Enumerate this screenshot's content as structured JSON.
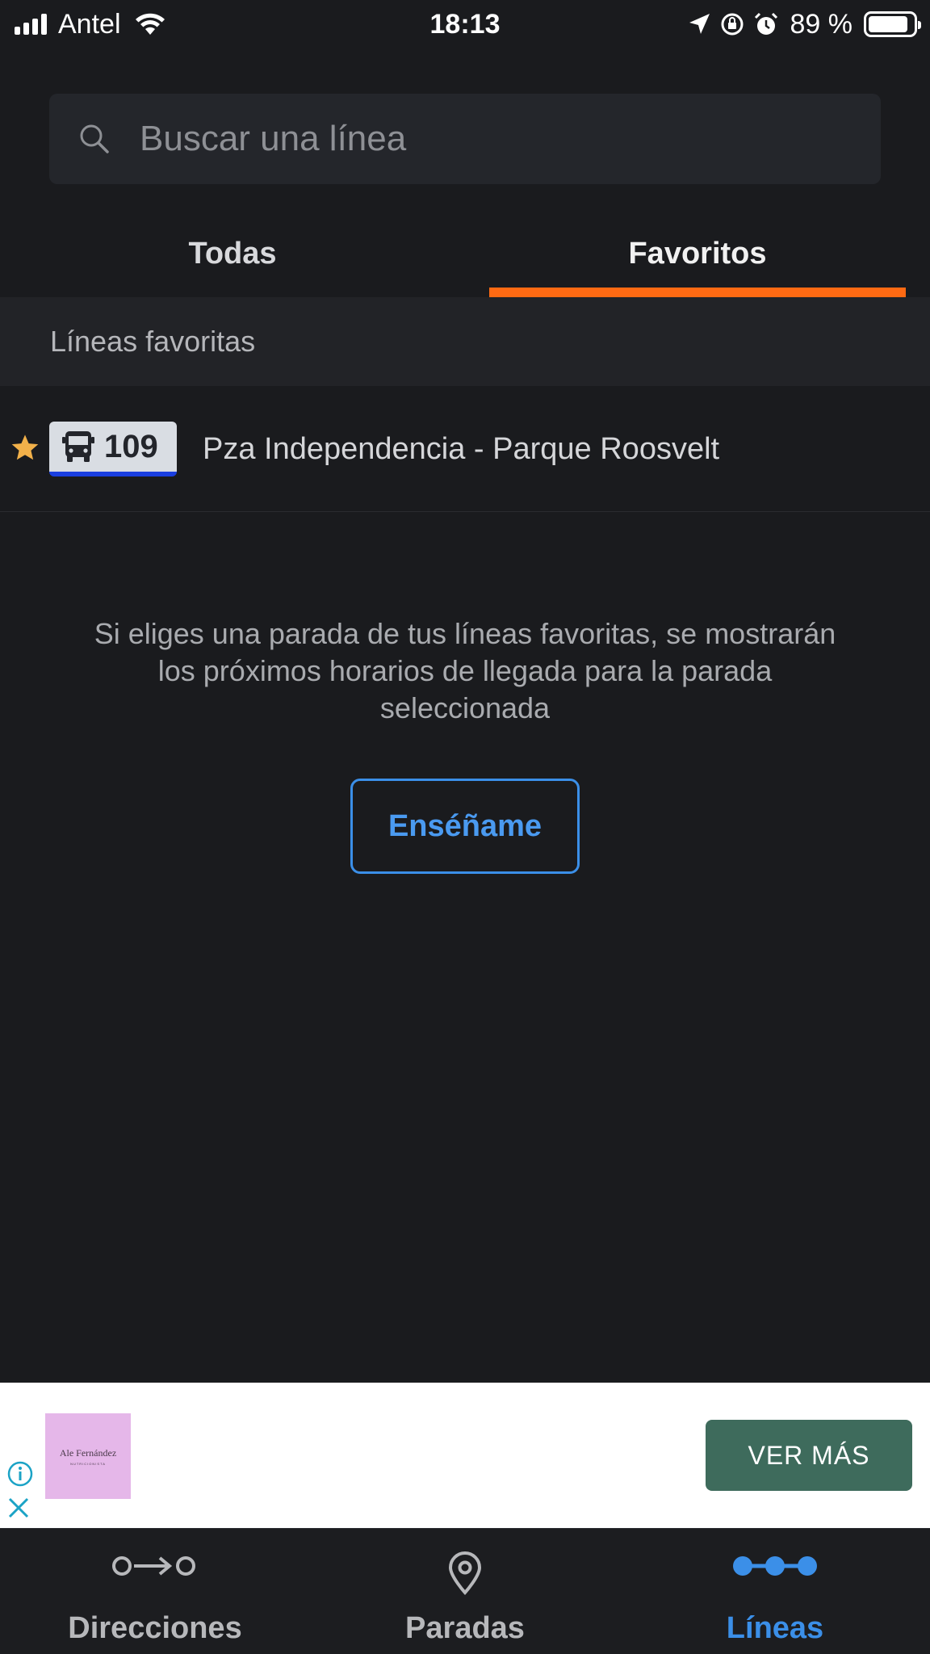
{
  "status_bar": {
    "carrier": "Antel",
    "time": "18:13",
    "battery_percent": "89 %",
    "battery_level": 0.89,
    "icons": [
      "signal-icon",
      "wifi-icon",
      "location-icon",
      "rotation-lock-icon",
      "alarm-icon",
      "battery-icon"
    ]
  },
  "search": {
    "placeholder": "Buscar una línea",
    "value": ""
  },
  "tabs": {
    "all_label": "Todas",
    "favorites_label": "Favoritos",
    "active": "Favoritos",
    "indicator_color": "#ff6a13"
  },
  "favorites": {
    "section_title": "Líneas favoritas",
    "lines": [
      {
        "number": "109",
        "route": "Pza Independencia - Parque Roosvelt",
        "badge_color": "#d9dde3",
        "accent_color": "#1a3fe0"
      }
    ]
  },
  "info": {
    "text": "Si eliges una parada de tus líneas favoritas, se mostrarán los próximos horarios de llegada para la parada seleccionada",
    "button_label": "Enséñame"
  },
  "ad": {
    "brand": "Ale Fernández",
    "brand_sub": "NUTRICIONISTA",
    "cta_label": "VER MÁS",
    "cta_color": "#3e6b5c"
  },
  "bottom_nav": {
    "items": [
      {
        "label": "Direcciones",
        "icon": "directions-icon"
      },
      {
        "label": "Paradas",
        "icon": "map-pin-icon"
      },
      {
        "label": "Líneas",
        "icon": "lines-icon",
        "active": true
      }
    ],
    "active_color": "#3b8fe8"
  }
}
